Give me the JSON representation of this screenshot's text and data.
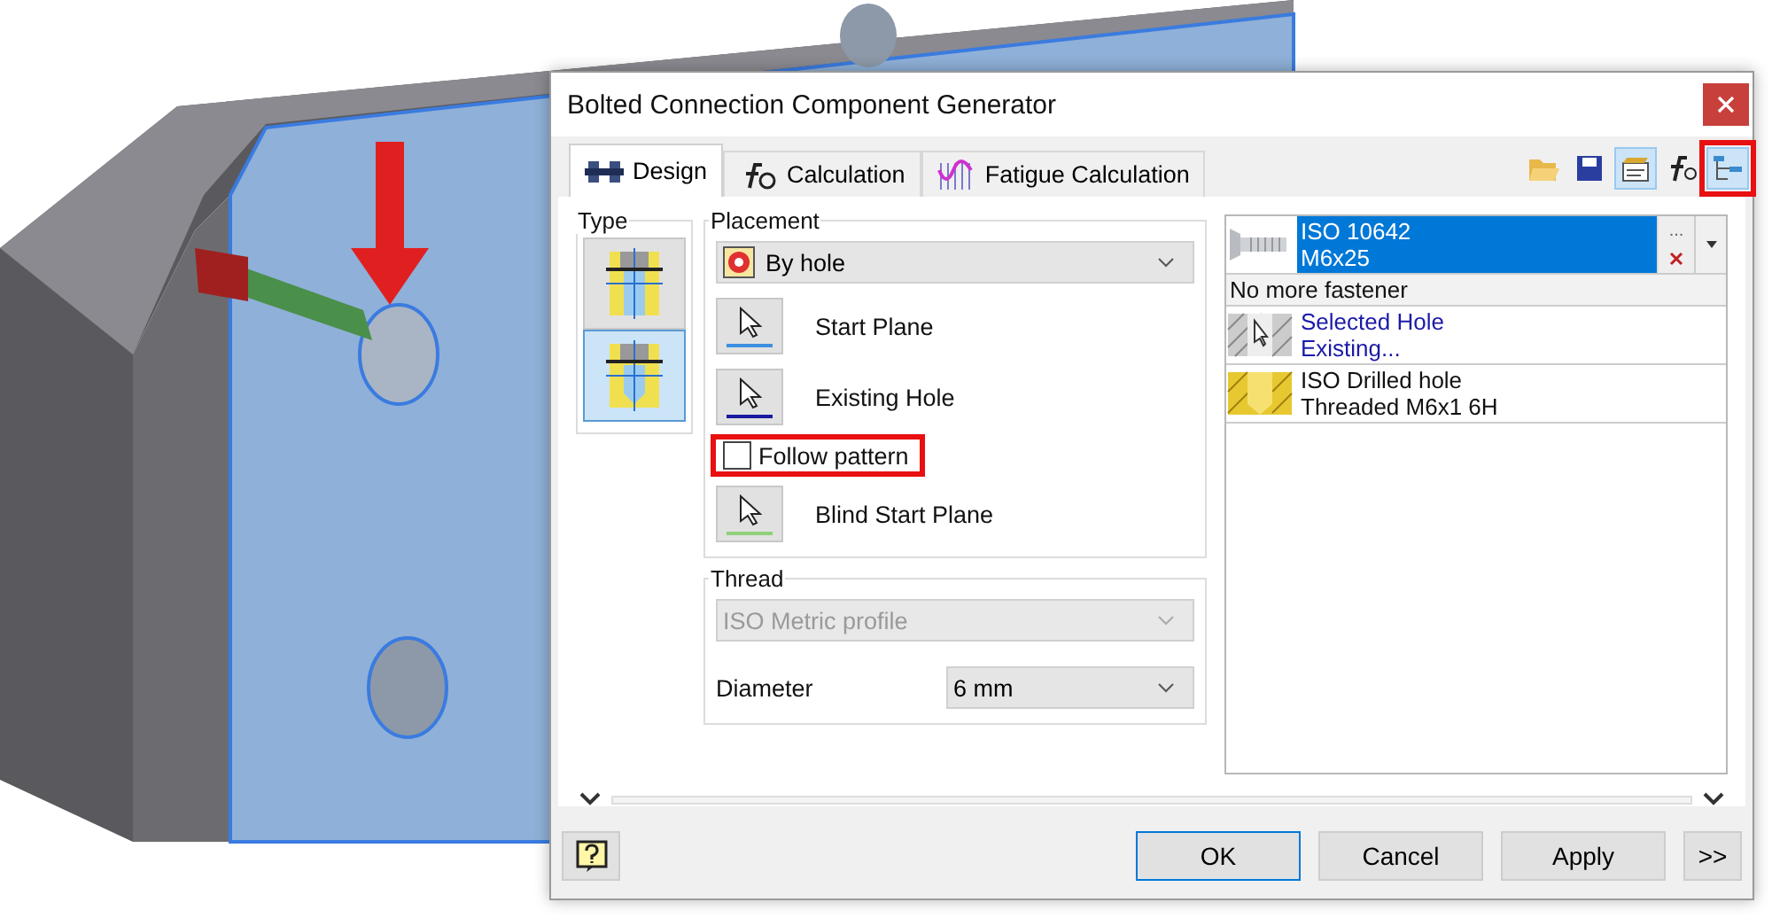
{
  "window": {
    "title": "Bolted Connection Component Generator"
  },
  "tabs": [
    {
      "label": "Design",
      "kind": "design",
      "selected": true
    },
    {
      "label": "Calculation",
      "kind": "calc",
      "selected": false
    },
    {
      "label": "Fatigue Calculation",
      "kind": "fatigue",
      "selected": false
    }
  ],
  "toolbar": [
    {
      "kind": "open",
      "selected": false,
      "highlighted": false
    },
    {
      "kind": "save",
      "selected": false,
      "highlighted": false
    },
    {
      "kind": "options",
      "selected": true,
      "highlighted": false
    },
    {
      "kind": "formula",
      "selected": false,
      "highlighted": false
    },
    {
      "kind": "tree",
      "selected": true,
      "highlighted": true
    }
  ],
  "type": {
    "title": "Type",
    "options": [
      {
        "kind": "through",
        "selected": false
      },
      {
        "kind": "blind",
        "selected": true
      }
    ]
  },
  "placement": {
    "title": "Placement",
    "method": "By hole",
    "rows": [
      {
        "kind": "select",
        "label": "Start Plane",
        "color": "#3d8fe0"
      },
      {
        "kind": "select",
        "label": "Existing Hole",
        "color": "#1a1aa0"
      },
      {
        "kind": "checkbox",
        "label": "Follow pattern",
        "checked": false,
        "highlighted": true
      },
      {
        "kind": "select",
        "label": "Blind Start Plane",
        "color": "#8fd07a"
      }
    ]
  },
  "thread": {
    "title": "Thread",
    "standard": "ISO Metric profile",
    "standard_disabled": true,
    "diameter_label": "Diameter",
    "diameter": "6 mm"
  },
  "fasteners": [
    {
      "kind": "bolt",
      "line1": "ISO 10642",
      "line2": "M6x25",
      "selected": true,
      "more": "..."
    },
    {
      "kind": "note",
      "line1": "No more fastener"
    },
    {
      "kind": "hole",
      "line1": "Selected Hole",
      "line2": "Existing...",
      "link": true
    },
    {
      "kind": "thread",
      "line1": "ISO Drilled hole",
      "line2": "Threaded M6x1 6H",
      "link": false
    }
  ],
  "buttons": [
    {
      "label": "OK",
      "default": true
    },
    {
      "label": "Cancel",
      "default": false
    },
    {
      "label": "Apply",
      "default": false
    }
  ],
  "more_button": ">>"
}
